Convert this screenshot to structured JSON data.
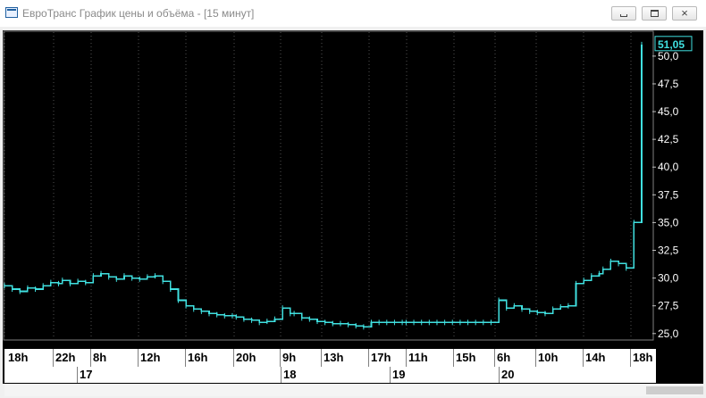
{
  "window": {
    "title": "ЕвроТранс График цены и объёма - [15 минут]",
    "controls": {
      "minimize": "minimize",
      "maximize": "maximize",
      "close": "×"
    }
  },
  "colors": {
    "background": "#000000",
    "price_line": "#40e0e0",
    "grid": "#808080",
    "axis_text": "#ffffff"
  },
  "chart_data": {
    "type": "line",
    "title": "",
    "xlabel": "",
    "ylabel": "",
    "ylim": [
      24.5,
      52.0
    ],
    "last_price_label": "51,05",
    "y_ticks": [
      "25,0",
      "27,5",
      "30,0",
      "32,5",
      "35,0",
      "37,5",
      "40,0",
      "42,5",
      "45,0",
      "47,5",
      "50,0"
    ],
    "x_time_labels": [
      "18h",
      "22h",
      "8h",
      "12h",
      "16h",
      "20h",
      "9h",
      "13h",
      "17h",
      "11h",
      "15h",
      "6h",
      "10h",
      "14h",
      "18h"
    ],
    "x_date_labels": [
      "17",
      "18",
      "19",
      "20"
    ],
    "grid": "vertical-dotted",
    "series": [
      {
        "x_index": [
          0,
          4,
          8,
          12,
          16,
          20,
          24,
          28,
          30,
          34,
          38,
          42,
          46,
          50,
          54,
          58,
          62,
          66,
          70,
          74,
          78,
          82,
          86,
          90,
          94,
          98,
          102,
          106,
          110,
          114,
          118,
          120,
          124,
          128,
          132,
          136,
          140,
          144,
          148,
          150,
          154,
          158,
          162,
          166,
          170,
          174,
          178,
          182,
          186,
          190,
          194,
          198,
          202,
          206,
          208,
          212,
          216,
          220,
          224,
          228,
          232,
          236,
          240,
          244,
          248,
          252,
          256,
          260,
          264,
          268,
          272,
          276,
          280,
          284,
          288,
          292,
          296,
          300,
          304,
          308,
          310,
          314,
          318,
          322,
          326,
          330
        ],
        "values": [
          29.3,
          29.0,
          28.8,
          29.1,
          29.0,
          29.3,
          29.6,
          29.5,
          29.8,
          29.5,
          29.7,
          29.6,
          30.2,
          30.4,
          30.1,
          29.9,
          30.2,
          30.0,
          29.9,
          30.1,
          30.2,
          29.7,
          29.0,
          28.0,
          27.5,
          27.2,
          27.0,
          26.8,
          26.7,
          26.6,
          26.6,
          26.5,
          26.3,
          26.2,
          26.0,
          26.1,
          26.3,
          27.3,
          26.8,
          26.8,
          26.4,
          26.3,
          26.1,
          26.0,
          25.9,
          25.9,
          25.8,
          25.7,
          25.6,
          26.0,
          26.0,
          26.0,
          26.0,
          26.0,
          26.0,
          26.0,
          26.0,
          26.0,
          26.0,
          26.0,
          26.0,
          26.0,
          26.0,
          26.0,
          26.0,
          26.0,
          28.0,
          27.3,
          27.5,
          27.2,
          27.0,
          26.9,
          26.8,
          27.2,
          27.4,
          27.5,
          29.5,
          29.8,
          30.2,
          30.4,
          30.8,
          31.5,
          31.3,
          30.9,
          35.0,
          51.05
        ]
      }
    ]
  }
}
